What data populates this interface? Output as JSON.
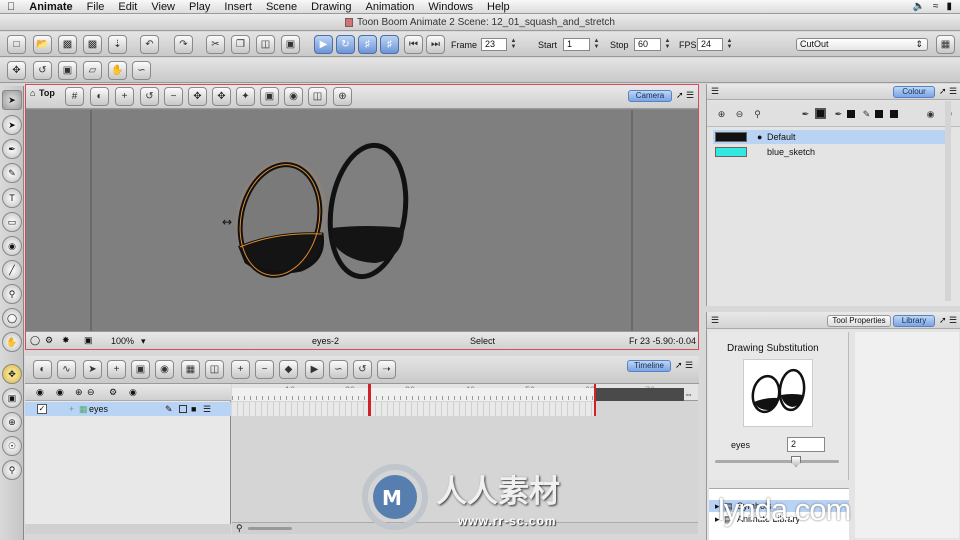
{
  "menubar": {
    "apple": "",
    "items": [
      "Animate",
      "File",
      "Edit",
      "View",
      "Play",
      "Insert",
      "Scene",
      "Drawing",
      "Animation",
      "Windows",
      "Help"
    ]
  },
  "window": {
    "title": "Toon Boom Animate 2 Scene: 12_01_squash_and_stretch"
  },
  "playback": {
    "frame_label": "Frame",
    "frame_value": "23",
    "start_label": "Start",
    "start_value": "1",
    "stop_label": "Stop",
    "stop_value": "60",
    "fps_label": "FPS",
    "fps_value": "24"
  },
  "workspace": {
    "selected": "CutOut"
  },
  "camera_view": {
    "view_name": "Top",
    "tab_label": "Camera",
    "zoom": "100%",
    "current_element": "eyes-2",
    "tool_status": "Select",
    "frame_coords": "Fr 23  -5.90:-0.04"
  },
  "timeline": {
    "tab_label": "Timeline",
    "ruler_ticks": [
      "10",
      "20",
      "30",
      "40",
      "50",
      "60",
      "70"
    ],
    "current_frame": 23,
    "stop_frame": 60,
    "layers": [
      {
        "name": "eyes"
      }
    ]
  },
  "colour_panel": {
    "tab_label": "Colour",
    "swatches": [
      {
        "name": "Default",
        "color": "#111111",
        "selected": true
      },
      {
        "name": "blue_sketch",
        "color": "#33e8e0",
        "selected": false
      }
    ]
  },
  "library_panel": {
    "tab_tool_properties": "Tool Properties",
    "tab_library": "Library",
    "section_title": "Drawing Substitution",
    "element_label": "eyes",
    "element_value": "2",
    "tree": [
      "Symbols",
      "Animate Library"
    ]
  },
  "watermark": {
    "text_cn": "人人素材",
    "url": "www.rr-sc.com"
  },
  "branding": {
    "lynda": "lynda.com"
  },
  "colors": {
    "accent_blue": "#7aa5e4",
    "camera_border": "#d64b5a",
    "playhead": "#d0202a",
    "drawing_outline": "#111111",
    "selection_outline": "#e08a2c"
  }
}
